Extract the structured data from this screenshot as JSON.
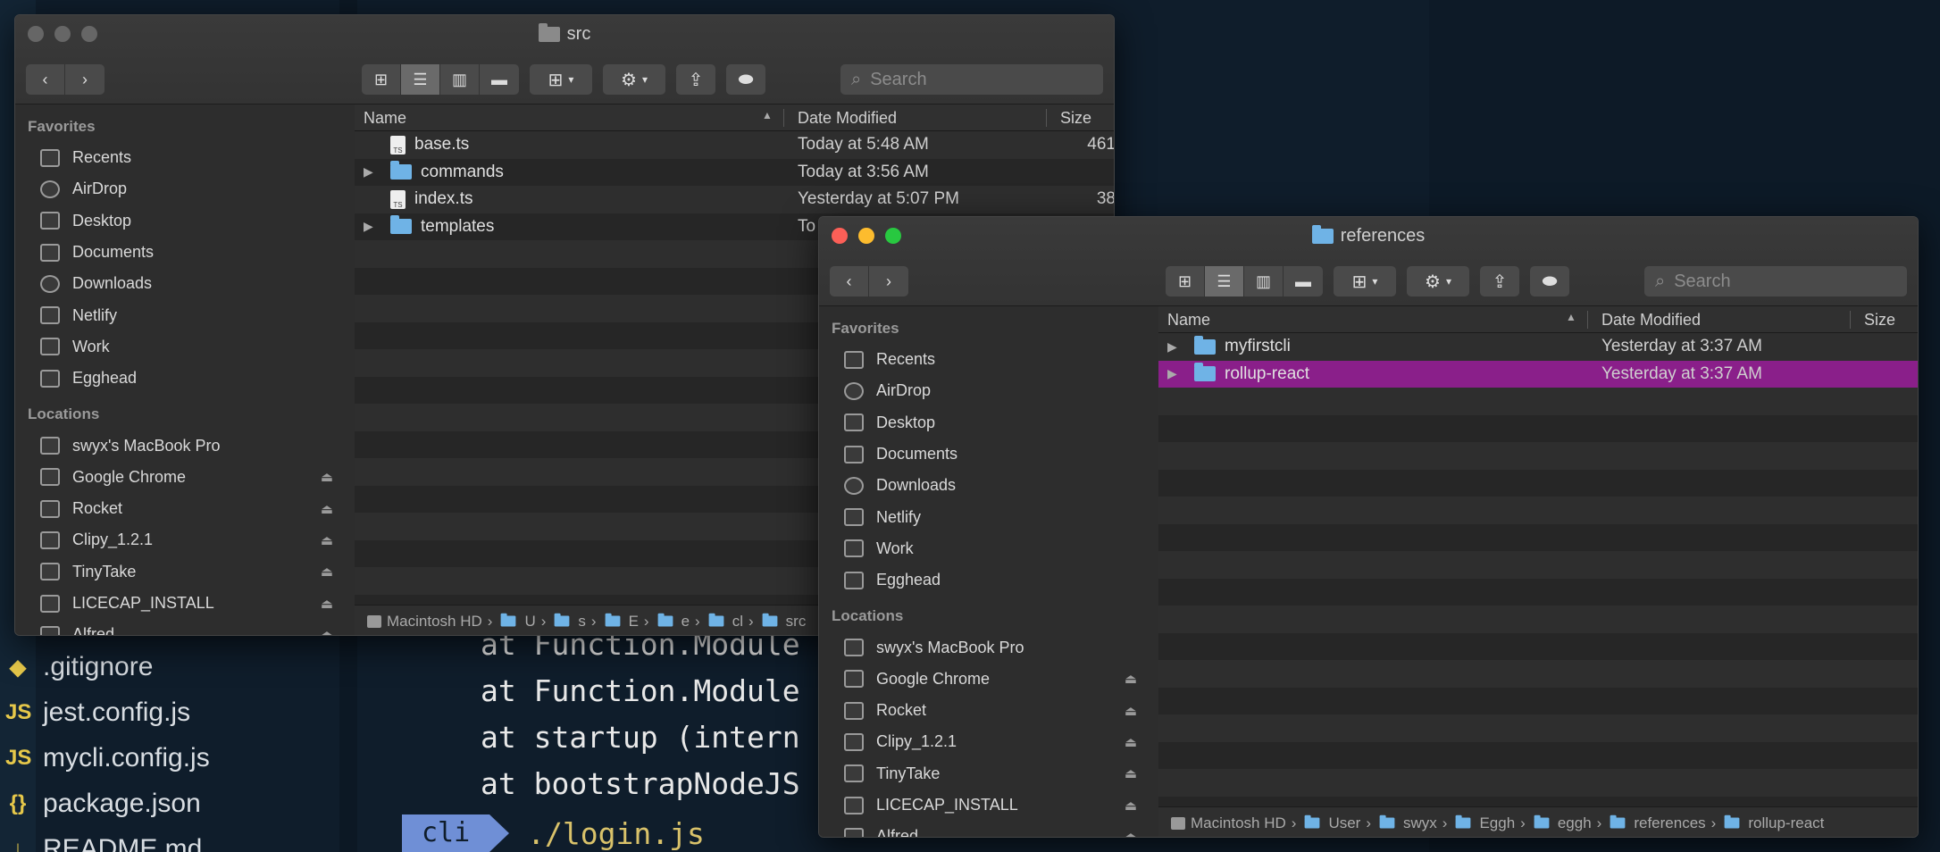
{
  "terminal": {
    "file_tree": [
      {
        "icon": "git-icon",
        "glyph": "◆",
        "name": ".gitignore"
      },
      {
        "icon": "js-icon",
        "glyph": "JS",
        "name": "jest.config.js"
      },
      {
        "icon": "js-icon",
        "glyph": "JS",
        "name": "mycli.config.js"
      },
      {
        "icon": "json-icon",
        "glyph": "{}",
        "name": "package.json"
      },
      {
        "icon": "markdown-icon",
        "glyph": "↓",
        "name": "README.md"
      }
    ],
    "output_lines": [
      "at Function.Module",
      "at Function.Module",
      "at startup (intern",
      "at bootstrapNodeJS"
    ],
    "prompt_label": "cli",
    "command": "./login.js"
  },
  "src_window": {
    "title": "src",
    "search_placeholder": "Search",
    "sidebar": {
      "favorites_heading": "Favorites",
      "favorites": [
        "Recents",
        "AirDrop",
        "Desktop",
        "Documents",
        "Downloads",
        "Netlify",
        "Work",
        "Egghead"
      ],
      "locations_heading": "Locations",
      "locations": [
        "swyx's MacBook Pro",
        "Google Chrome",
        "Rocket",
        "Clipy_1.2.1",
        "TinyTake",
        "LICECAP_INSTALL",
        "Alfred"
      ]
    },
    "columns": {
      "name": "Name",
      "date": "Date Modified",
      "size": "Size"
    },
    "rows": [
      {
        "kind": "file",
        "name": "base.ts",
        "date": "Today at 5:48 AM",
        "size": "461"
      },
      {
        "kind": "folder",
        "name": "commands",
        "date": "Today at 3:56 AM",
        "size": ""
      },
      {
        "kind": "file",
        "name": "index.ts",
        "date": "Yesterday at 5:07 PM",
        "size": "38"
      },
      {
        "kind": "folder",
        "name": "templates",
        "date": "To",
        "size": ""
      }
    ],
    "path": [
      "Macintosh HD",
      "U",
      "s",
      "E",
      "e",
      "cl",
      "src"
    ]
  },
  "ref_window": {
    "title": "references",
    "search_placeholder": "Search",
    "sidebar": {
      "favorites_heading": "Favorites",
      "favorites": [
        "Recents",
        "AirDrop",
        "Desktop",
        "Documents",
        "Downloads",
        "Netlify",
        "Work",
        "Egghead"
      ],
      "locations_heading": "Locations",
      "locations": [
        "swyx's MacBook Pro",
        "Google Chrome",
        "Rocket",
        "Clipy_1.2.1",
        "TinyTake",
        "LICECAP_INSTALL",
        "Alfred"
      ]
    },
    "columns": {
      "name": "Name",
      "date": "Date Modified",
      "size": "Size"
    },
    "rows": [
      {
        "kind": "folder",
        "name": "myfirstcli",
        "date": "Yesterday at 3:37 AM",
        "size": "",
        "selected": false
      },
      {
        "kind": "folder",
        "name": "rollup-react",
        "date": "Yesterday at 3:37 AM",
        "size": "",
        "selected": true
      }
    ],
    "path": [
      "Macintosh HD",
      "User",
      "swyx",
      "Eggh",
      "eggh",
      "references",
      "rollup-react"
    ]
  },
  "colors": {
    "selection": "#8a1f8a",
    "folder": "#6fb3e6",
    "close": "#fc5f57",
    "minimize": "#fdbc2e",
    "zoom": "#28c840"
  }
}
